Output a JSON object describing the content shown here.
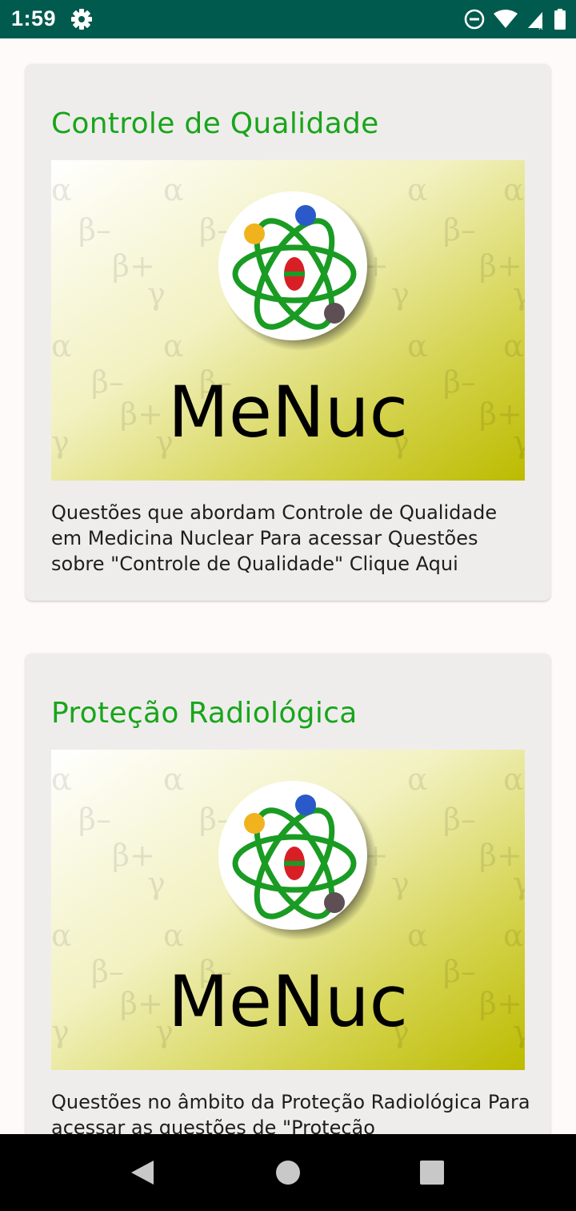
{
  "status_bar": {
    "time": "1:59",
    "icons": [
      "gear-icon",
      "do-not-disturb-icon",
      "wifi-icon",
      "cell-signal-icon",
      "battery-icon"
    ]
  },
  "cards": [
    {
      "title": "Controle de Qualidade",
      "image_text": "MeNuc",
      "description": "Questões que abordam Controle de Qualidade em Medicina Nuclear Para acessar Questões sobre \"Controle de Qualidade\" Clique Aqui"
    },
    {
      "title": "Proteção Radiológica",
      "image_text": "MeNuc",
      "description": "Questões no âmbito da Proteção Radiológica Para acessar as questões de \"Proteção"
    }
  ],
  "colors": {
    "status_bar": "#005a4e",
    "title_green": "#19a51b",
    "card_background": "#efedec",
    "page_background": "#fdfaf9",
    "logo_gradient_end": "#bcbb00"
  },
  "nav_bar": {
    "icons": [
      "back-icon",
      "home-icon",
      "recents-icon"
    ]
  }
}
